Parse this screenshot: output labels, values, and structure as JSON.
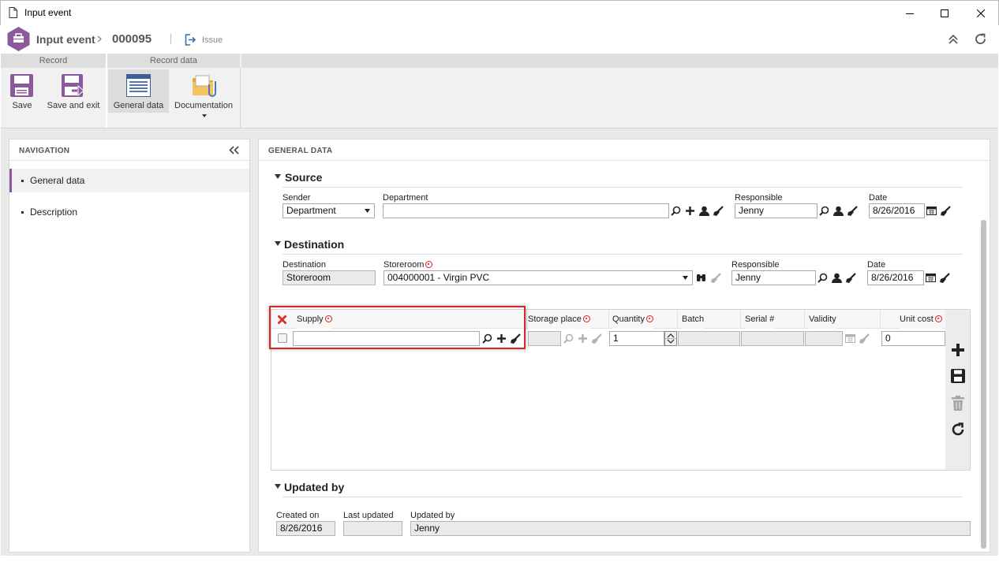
{
  "window": {
    "title": "Input event"
  },
  "header": {
    "module": "Input event",
    "record_id": "000095",
    "issue_label": "Issue"
  },
  "ribbon": {
    "groups": [
      {
        "label": "Record"
      },
      {
        "label": "Record data"
      }
    ],
    "buttons": [
      {
        "label": "Save",
        "icon": "save-icon"
      },
      {
        "label": "Save and exit",
        "icon": "save-exit-icon"
      },
      {
        "label": "General data",
        "icon": "form-icon"
      },
      {
        "label": "Documentation",
        "icon": "folder-clip-icon"
      }
    ]
  },
  "navigation": {
    "title": "NAVIGATION",
    "items": [
      {
        "label": "General data",
        "selected": true
      },
      {
        "label": "Description",
        "selected": false
      }
    ]
  },
  "general_data": {
    "title": "GENERAL DATA",
    "source": {
      "title": "Source",
      "sender_label": "Sender",
      "sender_value": "Department",
      "department_label": "Department",
      "department_value": "",
      "responsible_label": "Responsible",
      "responsible_value": "Jenny",
      "date_label": "Date",
      "date_value": "8/26/2016"
    },
    "destination": {
      "title": "Destination",
      "destination_label": "Destination",
      "destination_value": "Storeroom",
      "storeroom_label": "Storeroom",
      "storeroom_value": "004000001 - Virgin PVC",
      "responsible_label": "Responsible",
      "responsible_value": "Jenny",
      "date_label": "Date",
      "date_value": "8/26/2016"
    },
    "grid": {
      "columns": [
        "Supply",
        "Storage place",
        "Quantity",
        "Batch",
        "Serial #",
        "Validity",
        "Unit cost"
      ],
      "row": {
        "supply": "",
        "storage_place": "",
        "quantity": "1",
        "batch": "",
        "serial": "",
        "validity": "",
        "unit_cost": "0"
      }
    },
    "updated_by": {
      "title": "Updated by",
      "created_on_label": "Created on",
      "created_on_value": "8/26/2016",
      "last_updated_label": "Last updated",
      "last_updated_value": "",
      "updated_by_label": "Updated by",
      "updated_by_value": "Jenny"
    }
  },
  "colors": {
    "accent": "#8a5a9c",
    "highlight": "#d9262c",
    "required": "#d42020"
  }
}
